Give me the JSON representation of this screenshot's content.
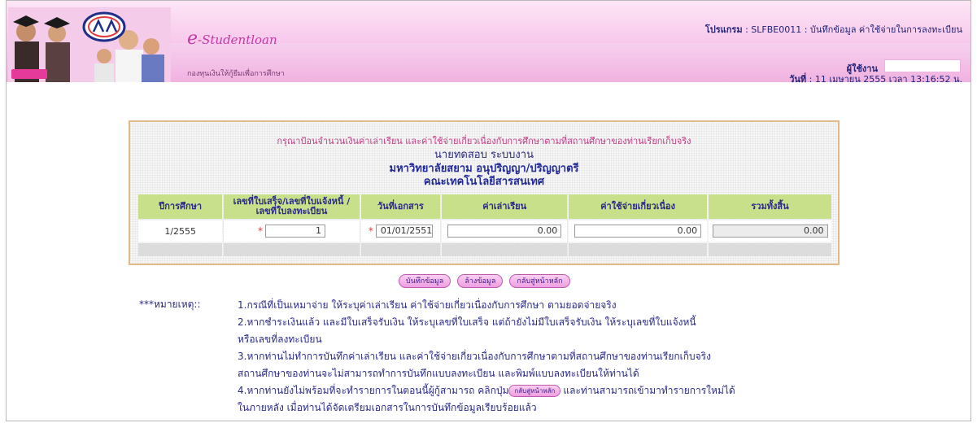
{
  "header": {
    "brand": "e-Studentloan",
    "brand_prefix": "e",
    "brand_suffix": "-Studentloan",
    "sub_brand": "กองทุนเงินให้กู้ยืมเพื่อการศึกษา",
    "program_label": "โปรแกรม",
    "program_value": ": SLFBE0011  : บันทึกข้อมูล ค่าใช้จ่ายในการลงทะเบียน",
    "user_label": "ผู้ใช้งาน",
    "date_label": "วันที่",
    "date_value": ": 11 เมษายน 2555 เวลา 13:16:52 น.",
    "logo_text": "กยศ"
  },
  "form": {
    "prompt": "กรุณาป้อนจำนวนเงินค่าเล่าเรียน และค่าใช้จ่ายเกี่ยวเนื่องกับการศึกษาตามที่สถานศึกษาของท่านเรียกเก็บจริง",
    "student_name": "นายทดสอบ ระบบงาน",
    "university": "มหาวิทยาลัยสยาม อนุปริญญา/ปริญญาตรี",
    "faculty": "คณะเทคโนโลยีสารสนเทศ",
    "columns": [
      "ปีการศึกษา",
      "เลขที่ใบเสร็จ/เลขที่ใบแจ้งหนี้ /เลขที่ใบลงทะเบียน",
      "วันที่เอกสาร",
      "ค่าเล่าเรียน",
      "ค่าใช้จ่ายเกี่ยวเนื่อง",
      "รวมทั้งสิ้น"
    ],
    "row": {
      "year": "1/2555",
      "receipt_no": "1",
      "doc_date": "01/01/2551",
      "tuition": "0.00",
      "related_cost": "0.00",
      "total": "0.00"
    },
    "required_mark": "*"
  },
  "buttons": {
    "save": "บันทึกข้อมูล",
    "clear": "ล้างข้อมูล",
    "back": "กลับสู่หน้าหลัก"
  },
  "notes": {
    "label": "***หมายเหตุ::",
    "line1": "1.กรณีที่เป็นเหมาจ่าย ให้ระบุค่าเล่าเรียน ค่าใช้จ่ายเกี่ยวเนื่องกับการศึกษา ตามยอดจ่ายจริง",
    "line2": "2.หากชำระเงินแล้ว และมีใบเสร็จรับเงิน ให้ระบุเลขที่ใบเสร็จ แต่ถ้ายังไม่มีใบเสร็จรับเงิน ให้ระบุเลขที่ใบแจ้งหนี้",
    "line3": "หรือเลขที่ลงทะเบียน",
    "line4": "3.หากท่านไม่ทำการบันทึกค่าเล่าเรียน และค่าใช้จ่ายเกี่ยวเนื่องกับการศึกษาตามที่สถานศึกษาของท่านเรียกเก็บจริง",
    "line5": "สถานศึกษาของท่านจะไม่สามารถทำการบันทึกแบบลงทะเบียน และพิมพ์แบบลงทะเบียนให้ท่านได้",
    "line6a": "4.หากท่านยังไม่พร้อมที่จะทำรายการในตอนนี้ผู้กู้สามารถ คลิกปุ่ม",
    "line6b": "และท่านสามารถเข้ามาทำรายการใหม่ได้",
    "line7": "ในภายหลัง เมื่อท่านได้จัดเตรียมเอกสารในการบันทึกข้อมูลเรียบร้อยแล้ว"
  }
}
